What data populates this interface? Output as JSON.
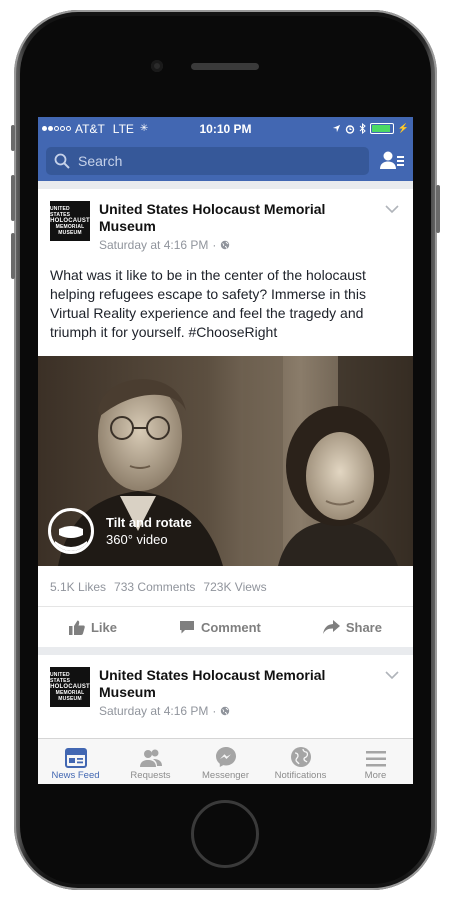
{
  "status": {
    "carrier": "AT&T",
    "network": "LTE",
    "time": "10:10 PM"
  },
  "search": {
    "placeholder": "Search"
  },
  "posts": [
    {
      "page_name": "United States Holocaust Memorial Museum",
      "timestamp": "Saturday at 4:16 PM",
      "logo_text": [
        "UNITED STATES",
        "HOLOCAUST",
        "MEMORIAL",
        "MUSEUM"
      ],
      "text": "What was it like to be in the center of the holocaust helping refugees escape to safety? Immerse in this Virtual Reality experience and feel the tragedy and triumph it for yourself. #ChooseRight",
      "video": {
        "title": "Tilt and rotate",
        "subtitle": "360° video"
      },
      "stats": {
        "likes": "5.1K Likes",
        "comments": "733 Comments",
        "views": "723K Views"
      },
      "actions": {
        "like": "Like",
        "comment": "Comment",
        "share": "Share"
      }
    },
    {
      "page_name": "United States Holocaust Memorial Museum",
      "timestamp": "Saturday at 4:16 PM",
      "logo_text": [
        "UNITED STATES",
        "HOLOCAUST",
        "MEMORIAL",
        "MUSEUM"
      ]
    }
  ],
  "tabs": [
    {
      "label": "News Feed",
      "icon": "news-feed-icon"
    },
    {
      "label": "Requests",
      "icon": "requests-icon"
    },
    {
      "label": "Messenger",
      "icon": "messenger-icon"
    },
    {
      "label": "Notifications",
      "icon": "notifications-icon"
    },
    {
      "label": "More",
      "icon": "more-icon"
    }
  ],
  "colors": {
    "brand": "#4267b2",
    "search_bg": "#365899",
    "feed_bg": "#e9ebee",
    "active_tab": "#4267b2"
  }
}
